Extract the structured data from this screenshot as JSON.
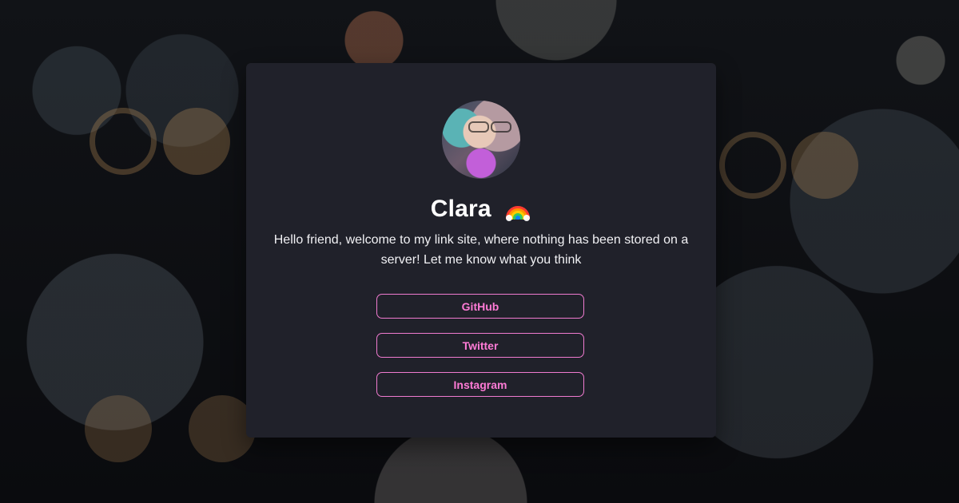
{
  "profile": {
    "name": "Clara",
    "emoji_icon": "rainbow-icon",
    "bio": "Hello friend, welcome to my link site, where nothing has been stored on a server! Let me know what you think"
  },
  "links": [
    {
      "label": "GitHub"
    },
    {
      "label": "Twitter"
    },
    {
      "label": "Instagram"
    }
  ],
  "colors": {
    "card_bg": "#20212a",
    "accent_pink": "#f07bd0",
    "text_white": "#ffffff"
  }
}
